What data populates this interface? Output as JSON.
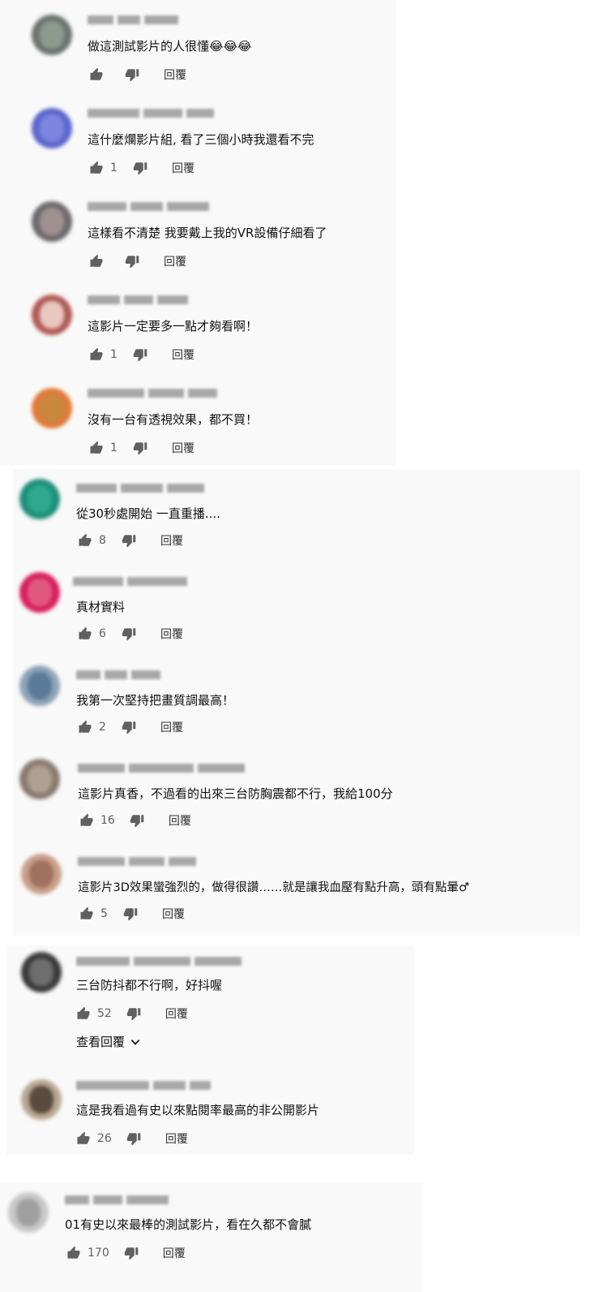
{
  "reply_label": "回覆",
  "panel2": {
    "view_replies_label": "查看回覆"
  },
  "comments": [
    {
      "text": "做這測試影片的人很懂😂😂😂",
      "likes": "",
      "avatar": "#6a7470",
      "avatar_fg": "#8d9a8e"
    },
    {
      "text": "這什麼爛影片組, 看了三個小時我還看不完",
      "likes": "1",
      "avatar": "#5b67cc",
      "avatar_fg": "#7c86e0"
    },
    {
      "text": "這樣看不清楚 我要戴上我的VR設備仔細看了",
      "likes": "",
      "avatar": "#6e6a6e",
      "avatar_fg": "#a09090"
    },
    {
      "text": "這影片一定要多一點才夠看啊！",
      "likes": "1",
      "avatar": "#b05a55",
      "avatar_fg": "#e8c8c0"
    },
    {
      "text": "沒有一台有透視效果，都不買！",
      "likes": "1",
      "avatar": "#e07a3a",
      "avatar_fg": "#c9883e"
    },
    {
      "text": "從30秒處開始 一直重播....",
      "likes": "8",
      "avatar": "#1f8f7a",
      "avatar_fg": "#2fa88e"
    },
    {
      "text": "真材實料",
      "likes": "6",
      "avatar": "#d8205e",
      "avatar_fg": "#e05a80"
    },
    {
      "text": "我第一次堅持把畫質調最高！",
      "likes": "2",
      "avatar": "#8fa4b8",
      "avatar_fg": "#5a7a99"
    },
    {
      "text": "這影片真香，不過看的出來三台防胸震都不行，我給100分",
      "likes": "16",
      "avatar": "#8a7a70",
      "avatar_fg": "#b0a090"
    },
    {
      "text": "這影片3D效果蠻強烈的，做得很讚……就是讓我血壓有點升高，頭有點暈♂",
      "likes": "5",
      "avatar": "#c9a08a",
      "avatar_fg": "#a07060"
    },
    {
      "text": "三台防抖都不行啊，好抖喔",
      "likes": "52",
      "avatar": "#3a3a3a",
      "avatar_fg": "#6e6e6e"
    },
    {
      "text": "這是我看過有史以來點閱率最高的非公開影片",
      "likes": "26",
      "avatar": "#b8a890",
      "avatar_fg": "#5a4a40"
    },
    {
      "text": "01有史以來最棒的測試影片，看在久都不會膩",
      "likes": "170",
      "avatar": "#c8c8c8",
      "avatar_fg": "#a0a0a0"
    }
  ]
}
